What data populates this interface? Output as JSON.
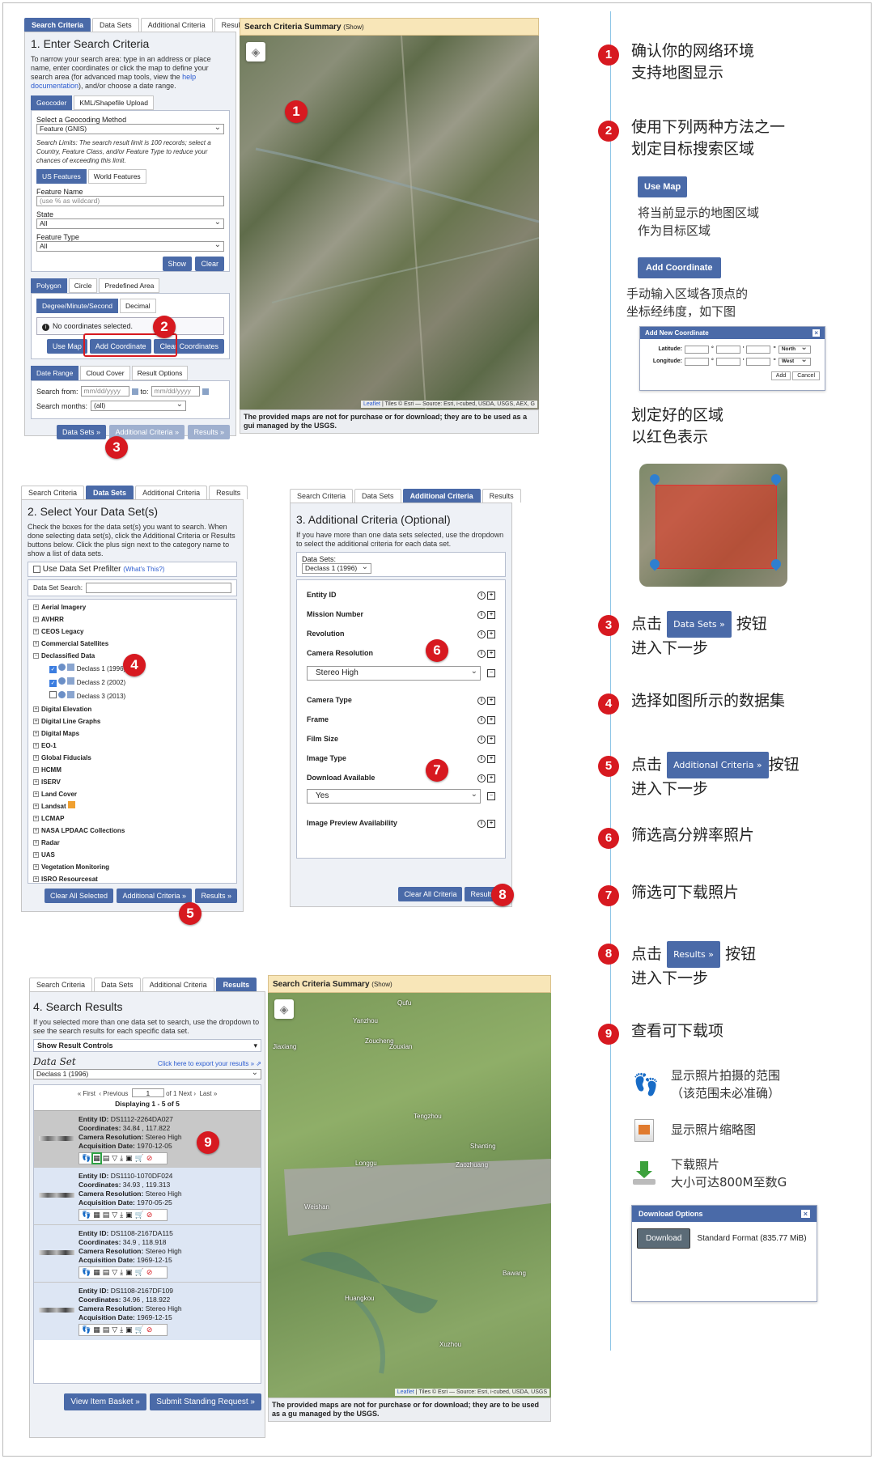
{
  "panel1": {
    "tabs": [
      "Search Criteria",
      "Data Sets",
      "Additional Criteria",
      "Results"
    ],
    "title": "1. Enter Search Criteria",
    "desc_pre": "To narrow your search area: type in an address or place name, enter coordinates or click the map to define your search area (for advanced map tools, view the ",
    "desc_link": "help documentation",
    "desc_post": "), and/or choose a date range.",
    "geo_tabs": [
      "Geocoder",
      "KML/Shapefile Upload"
    ],
    "method_label": "Select a Geocoding Method",
    "method_value": "Feature (GNIS)",
    "limits": "Search Limits: The search result limit is 100 records; select a Country, Feature Class, and/or Feature Type to reduce your chances of exceeding this limit.",
    "feature_tabs": [
      "US Features",
      "World Features"
    ],
    "feature_name_label": "Feature Name",
    "feature_name_placeholder": "(use % as wildcard)",
    "state_label": "State",
    "state_value": "All",
    "feature_type_label": "Feature Type",
    "feature_type_value": "All",
    "show": "Show",
    "clear": "Clear",
    "shape_tabs": [
      "Polygon",
      "Circle",
      "Predefined Area"
    ],
    "coord_tabs": [
      "Degree/Minute/Second",
      "Decimal"
    ],
    "no_coords": "No coordinates selected.",
    "use_map": "Use Map",
    "add_coordinate": "Add Coordinate",
    "clear_coordinates": "Clear Coordinates",
    "date_tabs": [
      "Date Range",
      "Cloud Cover",
      "Result Options"
    ],
    "search_from": "Search from:",
    "date_placeholder": "mm/dd/yyyy",
    "to": "to:",
    "search_months": "Search months:",
    "months_value": "(all)",
    "nav": [
      "Data Sets »",
      "Additional Criteria »",
      "Results »"
    ]
  },
  "map1": {
    "summary_title": "Search Criteria Summary",
    "summary_show": "(Show)",
    "attribution_link": "Leaflet",
    "attribution": " | Tiles © Esri — Source: Esri, i-cubed, USDA, USGS, AEX, G",
    "footer": "The provided maps are not for purchase or for download; they are to be used as a gui managed by the USGS."
  },
  "panel2": {
    "tabs": [
      "Search Criteria",
      "Data Sets",
      "Additional Criteria",
      "Results"
    ],
    "title": "2. Select Your Data Set(s)",
    "desc": "Check the boxes for the data set(s) you want to search. When done selecting data set(s), click the Additional Criteria or Results buttons below. Click the plus sign next to the category name to show a list of data sets.",
    "prefilter": "Use Data Set Prefilter",
    "whats_this": "(What's This?)",
    "search_label": "Data Set Search:",
    "categories_top": [
      "Aerial Imagery",
      "AVHRR",
      "CEOS Legacy",
      "Commercial Satellites",
      "Declassified Data"
    ],
    "declass": [
      "Declass 1 (1996)",
      "Declass 2 (2002)",
      "Declass 3 (2013)"
    ],
    "categories_bottom": [
      "Digital Elevation",
      "Digital Line Graphs",
      "Digital Maps",
      "EO-1",
      "Global Fiducials",
      "HCMM",
      "ISERV",
      "Land Cover",
      "Landsat",
      "LCMAP",
      "NASA LPDAAC Collections",
      "Radar",
      "UAS",
      "Vegetation Monitoring",
      "ISRO Resourcesat"
    ],
    "buttons": [
      "Clear All Selected",
      "Additional Criteria »",
      "Results »"
    ]
  },
  "panel3": {
    "tabs": [
      "Search Criteria",
      "Data Sets",
      "Additional Criteria",
      "Results"
    ],
    "title": "3. Additional Criteria (Optional)",
    "desc": "If you have more than one data sets selected, use the dropdown to select the additional criteria for each data set.",
    "datasets_label": "Data Sets:",
    "datasets_value": "Declass 1 (1996)",
    "rows": [
      "Entity ID",
      "Mission Number",
      "Revolution",
      "Camera Resolution",
      "Camera Type",
      "Frame",
      "Film Size",
      "Image Type",
      "Download Available",
      "Image Preview Availability"
    ],
    "camera_value": "Stereo High",
    "download_value": "Yes",
    "buttons": [
      "Clear All Criteria",
      "Results »"
    ]
  },
  "panel4": {
    "tabs": [
      "Search Criteria",
      "Data Sets",
      "Additional Criteria",
      "Results"
    ],
    "title": "4. Search Results",
    "desc": "If you selected more than one data set to search, use the dropdown to see the search results for each specific data set.",
    "controls": "Show Result Controls",
    "dataset_label": "Data Set",
    "export": "Click here to export your results »",
    "dataset_value": "Declass 1 (1996)",
    "pager_first": "« First",
    "pager_prev": "‹ Previous",
    "page_value": "1",
    "of": "of 1",
    "pager_next": "Next ›",
    "pager_last": "Last »",
    "displaying": "Displaying 1 - 5 of 5",
    "items": [
      {
        "entity": "DS1112-2264DA027",
        "coords": "34.84 , 117.822",
        "res": "Stereo High",
        "date": "1970-12-05"
      },
      {
        "entity": "DS1110-1070DF024",
        "coords": "34.93 , 119.313",
        "res": "Stereo High",
        "date": "1970-05-25"
      },
      {
        "entity": "DS1108-2167DA115",
        "coords": "34.9 , 118.918",
        "res": "Stereo High",
        "date": "1969-12-15"
      },
      {
        "entity": "DS1108-2167DF109",
        "coords": "34.96 , 118.922",
        "res": "Stereo High",
        "date": "1969-12-15"
      }
    ],
    "labels": {
      "entity": "Entity ID:",
      "coords": "Coordinates:",
      "res": "Camera Resolution:",
      "date": "Acquisition Date:"
    },
    "buttons": [
      "View Item Basket »",
      "Submit Standing Request »"
    ]
  },
  "map2": {
    "summary_title": "Search Criteria Summary",
    "summary_show": "(Show)",
    "places": [
      "Qufu",
      "Yanzhou",
      "Zoucheng",
      "Jiaxiang",
      "Zouxian",
      "Tengzhou",
      "Longgu",
      "Zaozhuang",
      "Shanting",
      "Weishan",
      "Bawang",
      "Huangkou",
      "Xuzhou"
    ],
    "attribution_link": "Leaflet",
    "attribution": " | Tiles © Esri — Source: Esri, i-cubed, USDA, USGS",
    "footer": "The provided maps are not for purchase or for download; they are to be used as a gu managed by the USGS."
  },
  "right": {
    "step1_a": "确认你的网络环境",
    "step1_b": "支持地图显示",
    "step2_a": "使用下列两种方法之一",
    "step2_b": "划定目标搜索区域",
    "use_map": "Use Map",
    "use_map_note_a": "将当前显示的地图区域",
    "use_map_note_b": "作为目标区域",
    "add_coord": "Add Coordinate",
    "add_coord_note_a": "手动输入区域各顶点的",
    "add_coord_note_b": "坐标经纬度，如下图",
    "coord_win_title": "Add New Coordinate",
    "lat": "Latitude:",
    "lon": "Longitude:",
    "north": "North",
    "west": "West",
    "add": "Add",
    "cancel": "Cancel",
    "region_a": "划定好的区域",
    "region_b": "以红色表示",
    "step3_pre": "点击",
    "step3_btn": "Data Sets »",
    "step3_post": "按钮",
    "step3_b": "进入下一步",
    "step4": "选择如图所示的数据集",
    "step5_pre": "点击",
    "step5_btn": "Additional Criteria »",
    "step5_post": "按钮",
    "step5_b": "进入下一步",
    "step6": "筛选高分辨率照片",
    "step7": "筛选可下载照片",
    "step8_pre": "点击",
    "step8_btn": "Results »",
    "step8_post": "按钮",
    "step8_b": "进入下一步",
    "step9": "查看可下载项",
    "icon1_a": "显示照片拍摄的范围",
    "icon1_b": "（该范围未必准确）",
    "icon2": "显示照片缩略图",
    "icon3_a": "下载照片",
    "icon3_b": "大小可达800M至数G",
    "dl_title": "Download Options",
    "dl_btn": "Download",
    "dl_format": "Standard Format (835.77 MiB)"
  },
  "markers": [
    "1",
    "2",
    "3",
    "4",
    "5",
    "6",
    "7",
    "8",
    "9"
  ],
  "colors": {
    "accent": "#4a6aa8",
    "marker": "#d71920",
    "summary": "#f8e6b8"
  }
}
